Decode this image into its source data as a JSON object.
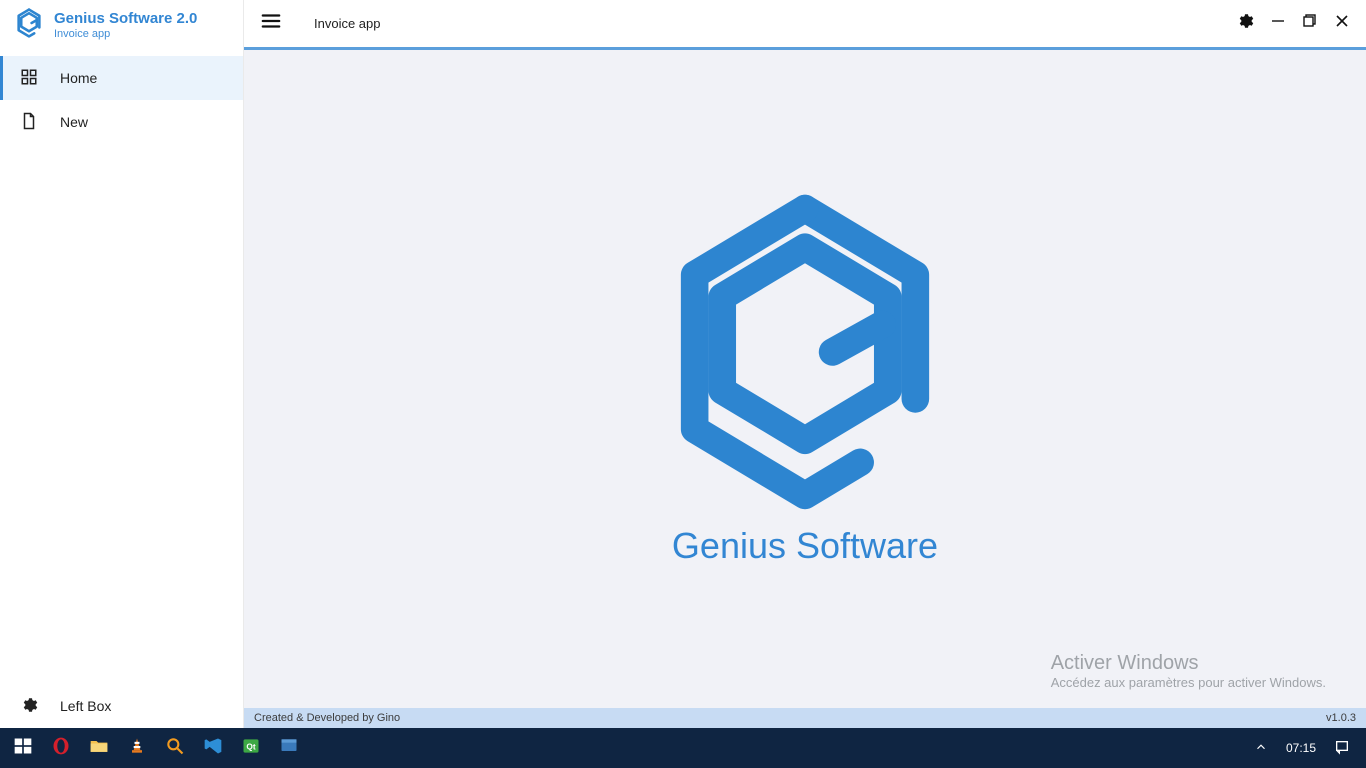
{
  "sidebar": {
    "title": "Genius Software 2.0",
    "subtitle": "Invoice app",
    "nav": [
      {
        "label": "Home"
      },
      {
        "label": "New"
      }
    ],
    "footer_label": "Left Box"
  },
  "topbar": {
    "title": "Invoice app"
  },
  "content": {
    "brand": "Genius Software"
  },
  "watermark": {
    "line1": "Activer Windows",
    "line2": "Accédez aux paramètres pour activer Windows."
  },
  "statusbar": {
    "credit": "Created & Developed by Gino",
    "version": "v1.0.3"
  },
  "taskbar": {
    "clock": "07:15"
  }
}
